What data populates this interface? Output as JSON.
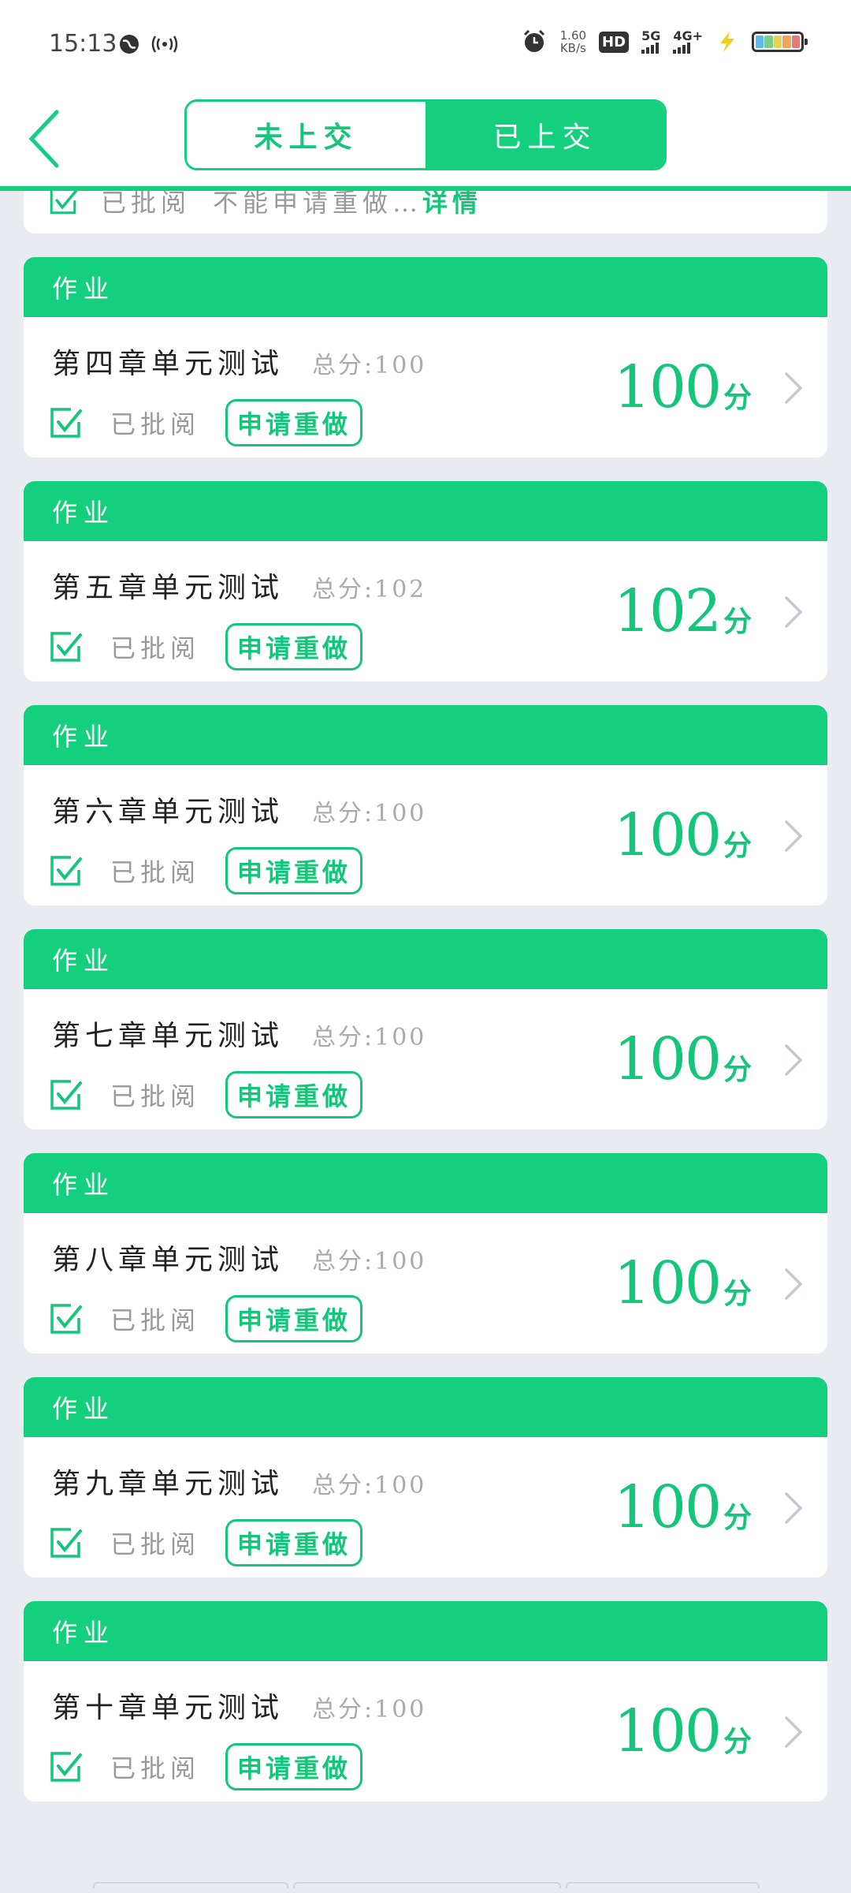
{
  "status_bar": {
    "time": "15:13",
    "speed_value": "1.60",
    "speed_unit": "KB/s",
    "hd": "HD",
    "sim1": "5G",
    "sim2": "4G+"
  },
  "header": {
    "tab_not_submitted": "未上交",
    "tab_submitted": "已上交",
    "active_tab": "已上交"
  },
  "partial_card": {
    "status": "已批阅",
    "note": "不能申请重做…",
    "detail_link": "详情"
  },
  "cards": [
    {
      "type": "作业",
      "title": "第四章单元测试",
      "total": "总分:100",
      "status": "已批阅",
      "redo": "申请重做",
      "score": "100",
      "unit": "分"
    },
    {
      "type": "作业",
      "title": "第五章单元测试",
      "total": "总分:102",
      "status": "已批阅",
      "redo": "申请重做",
      "score": "102",
      "unit": "分"
    },
    {
      "type": "作业",
      "title": "第六章单元测试",
      "total": "总分:100",
      "status": "已批阅",
      "redo": "申请重做",
      "score": "100",
      "unit": "分"
    },
    {
      "type": "作业",
      "title": "第七章单元测试",
      "total": "总分:100",
      "status": "已批阅",
      "redo": "申请重做",
      "score": "100",
      "unit": "分"
    },
    {
      "type": "作业",
      "title": "第八章单元测试",
      "total": "总分:100",
      "status": "已批阅",
      "redo": "申请重做",
      "score": "100",
      "unit": "分"
    },
    {
      "type": "作业",
      "title": "第九章单元测试",
      "total": "总分:100",
      "status": "已批阅",
      "redo": "申请重做",
      "score": "100",
      "unit": "分"
    },
    {
      "type": "作业",
      "title": "第十章单元测试",
      "total": "总分:100",
      "status": "已批阅",
      "redo": "申请重做",
      "score": "100",
      "unit": "分"
    }
  ],
  "colors": {
    "accent": "#14d07e",
    "accent_text": "#14c57a",
    "background": "#e8ebf0"
  },
  "icons": {
    "back": "chevron-left-icon",
    "reviewed": "check-square-icon",
    "row_arrow": "chevron-right-icon"
  }
}
